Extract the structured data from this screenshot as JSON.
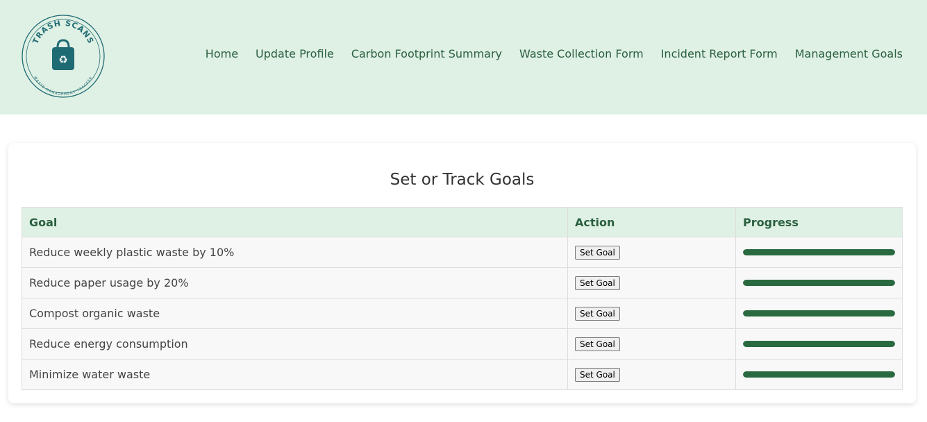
{
  "brand": {
    "name": "TRASH SCANS",
    "tagline": "WASTE MANAGEMENT TRACKER",
    "color": "#1f6b73"
  },
  "nav": [
    {
      "label": "Home"
    },
    {
      "label": "Update Profile"
    },
    {
      "label": "Carbon Footprint Summary"
    },
    {
      "label": "Waste Collection Form"
    },
    {
      "label": "Incident Report Form"
    },
    {
      "label": "Management Goals"
    }
  ],
  "page_title": "Set or Track Goals",
  "table": {
    "headers": [
      "Goal",
      "Action",
      "Progress"
    ],
    "rows": [
      {
        "goal": "Reduce weekly plastic waste by 10%",
        "action": "Set Goal",
        "progress": 1.0
      },
      {
        "goal": "Reduce paper usage by 20%",
        "action": "Set Goal",
        "progress": 1.0
      },
      {
        "goal": "Compost organic waste",
        "action": "Set Goal",
        "progress": 1.0
      },
      {
        "goal": "Reduce energy consumption",
        "action": "Set Goal",
        "progress": 1.0
      },
      {
        "goal": "Minimize water waste",
        "action": "Set Goal",
        "progress": 1.0
      }
    ]
  },
  "colors": {
    "header_bg": "#dff0e4",
    "accent": "#2a6040",
    "progress": "#2a6a40"
  }
}
